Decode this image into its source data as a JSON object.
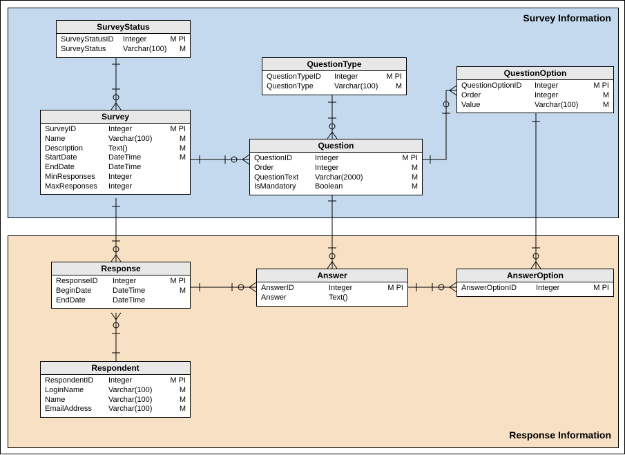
{
  "regions": {
    "survey": {
      "title": "Survey Information"
    },
    "response": {
      "title": "Response Information"
    }
  },
  "entities": {
    "SurveyStatus": {
      "title": "SurveyStatus",
      "attrs": [
        {
          "name": "SurveyStatusID",
          "type": "Integer",
          "flags": "M PI"
        },
        {
          "name": "SurveyStatus",
          "type": "Varchar(100)",
          "flags": "M"
        }
      ]
    },
    "Survey": {
      "title": "Survey",
      "attrs": [
        {
          "name": "SurveyID",
          "type": "Integer",
          "flags": "M PI"
        },
        {
          "name": "Name",
          "type": "Varchar(100)",
          "flags": "M"
        },
        {
          "name": "Description",
          "type": "Text()",
          "flags": "M"
        },
        {
          "name": "StartDate",
          "type": "DateTime",
          "flags": "M"
        },
        {
          "name": "EndDate",
          "type": "DateTime",
          "flags": ""
        },
        {
          "name": "MinResponses",
          "type": "Integer",
          "flags": ""
        },
        {
          "name": "MaxResponses",
          "type": "Integer",
          "flags": ""
        }
      ]
    },
    "QuestionType": {
      "title": "QuestionType",
      "attrs": [
        {
          "name": "QuestionTypeID",
          "type": "Integer",
          "flags": "M PI"
        },
        {
          "name": "QuestionType",
          "type": "Varchar(100)",
          "flags": "M"
        }
      ]
    },
    "Question": {
      "title": "Question",
      "attrs": [
        {
          "name": "QuestionID",
          "type": "Integer",
          "flags": "M PI"
        },
        {
          "name": "Order",
          "type": "Integer",
          "flags": "M"
        },
        {
          "name": "QuestionText",
          "type": "Varchar(2000)",
          "flags": "M"
        },
        {
          "name": "IsMandatory",
          "type": "Boolean",
          "flags": "M"
        }
      ]
    },
    "QuestionOption": {
      "title": "QuestionOption",
      "attrs": [
        {
          "name": "QuestionOptionID",
          "type": "Integer",
          "flags": "M PI"
        },
        {
          "name": "Order",
          "type": "Integer",
          "flags": "M"
        },
        {
          "name": "Value",
          "type": "Varchar(100)",
          "flags": "M"
        }
      ]
    },
    "Response": {
      "title": "Response",
      "attrs": [
        {
          "name": "ResponseID",
          "type": "Integer",
          "flags": "M PI"
        },
        {
          "name": "BeginDate",
          "type": "DateTime",
          "flags": "M"
        },
        {
          "name": "EndDate",
          "type": "DateTime",
          "flags": ""
        }
      ]
    },
    "Answer": {
      "title": "Answer",
      "attrs": [
        {
          "name": "AnswerID",
          "type": "Integer",
          "flags": "M PI"
        },
        {
          "name": "Answer",
          "type": "Text()",
          "flags": ""
        }
      ]
    },
    "AnswerOption": {
      "title": "AnswerOption",
      "attrs": [
        {
          "name": "AnswerOptionID",
          "type": "Integer",
          "flags": "M PI"
        }
      ]
    },
    "Respondent": {
      "title": "Respondent",
      "attrs": [
        {
          "name": "RespondentID",
          "type": "Integer",
          "flags": "M PI"
        },
        {
          "name": "LoginName",
          "type": "Varchar(100)",
          "flags": "M"
        },
        {
          "name": "Name",
          "type": "Varchar(100)",
          "flags": "M"
        },
        {
          "name": "EmailAddress",
          "type": "Varchar(100)",
          "flags": "M"
        }
      ]
    }
  },
  "relationships": [
    {
      "from": "SurveyStatus",
      "to": "Survey",
      "fromCard": "one",
      "toCard": "many"
    },
    {
      "from": "Survey",
      "to": "Question",
      "fromCard": "one",
      "toCard": "many"
    },
    {
      "from": "QuestionType",
      "to": "Question",
      "fromCard": "one",
      "toCard": "many"
    },
    {
      "from": "Question",
      "to": "QuestionOption",
      "fromCard": "one",
      "toCard": "many"
    },
    {
      "from": "Survey",
      "to": "Response",
      "fromCard": "one",
      "toCard": "many"
    },
    {
      "from": "Response",
      "to": "Answer",
      "fromCard": "one",
      "toCard": "many"
    },
    {
      "from": "Question",
      "to": "Answer",
      "fromCard": "one",
      "toCard": "many"
    },
    {
      "from": "Answer",
      "to": "AnswerOption",
      "fromCard": "one",
      "toCard": "many"
    },
    {
      "from": "QuestionOption",
      "to": "AnswerOption",
      "fromCard": "one",
      "toCard": "many"
    },
    {
      "from": "Respondent",
      "to": "Response",
      "fromCard": "one",
      "toCard": "many"
    }
  ]
}
